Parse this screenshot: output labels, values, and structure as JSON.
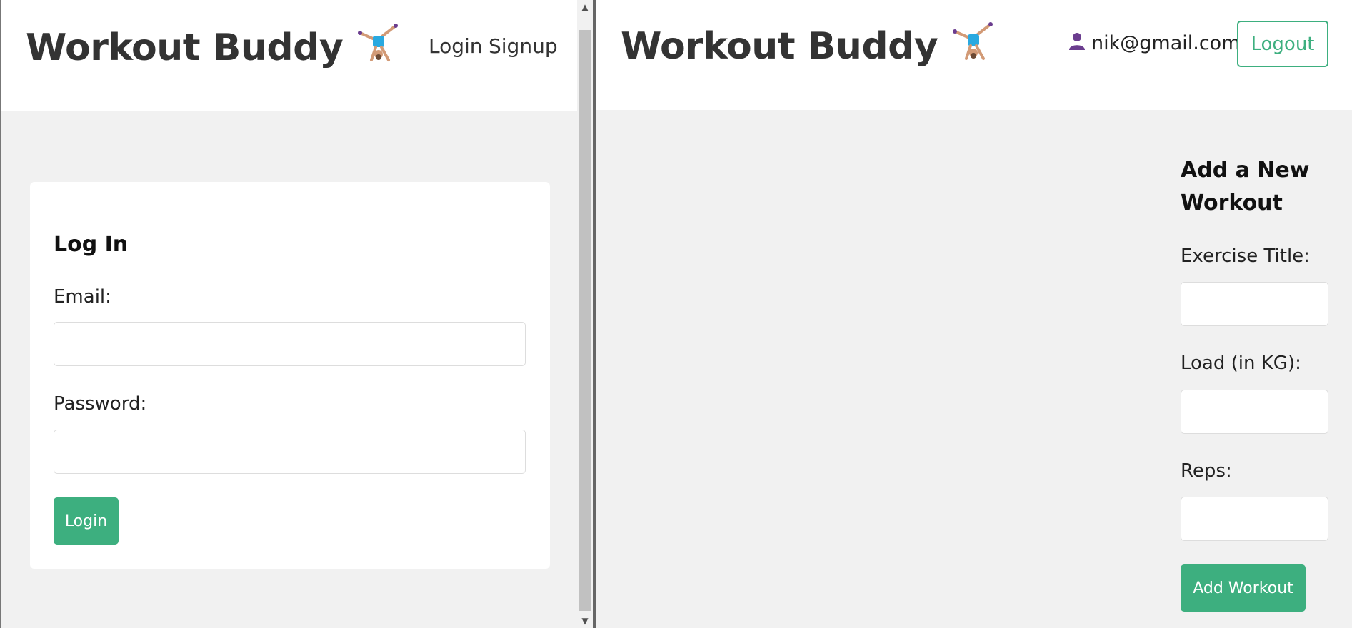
{
  "left_window": {
    "brand": "Workout Buddy",
    "brand_icon": "cartwheel-person-icon",
    "nav": {
      "login": "Login",
      "signup": "Signup"
    },
    "login_form": {
      "title": "Log In",
      "email_label": "Email:",
      "email_value": "",
      "password_label": "Password:",
      "password_value": "",
      "submit_label": "Login"
    }
  },
  "right_window": {
    "brand": "Workout Buddy",
    "brand_icon": "cartwheel-person-icon",
    "user_icon": "user-silhouette-icon",
    "user_email": "nik@gmail.com",
    "logout_label": "Logout",
    "workout_form": {
      "title": "Add a New Workout",
      "title_label": "Exercise Title:",
      "title_value": "",
      "load_label": "Load (in KG):",
      "load_value": "",
      "reps_label": "Reps:",
      "reps_value": "",
      "submit_label": "Add Workout"
    }
  },
  "colors": {
    "accent": "#3daf7f",
    "background": "#f1f1f1",
    "text": "#333333"
  }
}
